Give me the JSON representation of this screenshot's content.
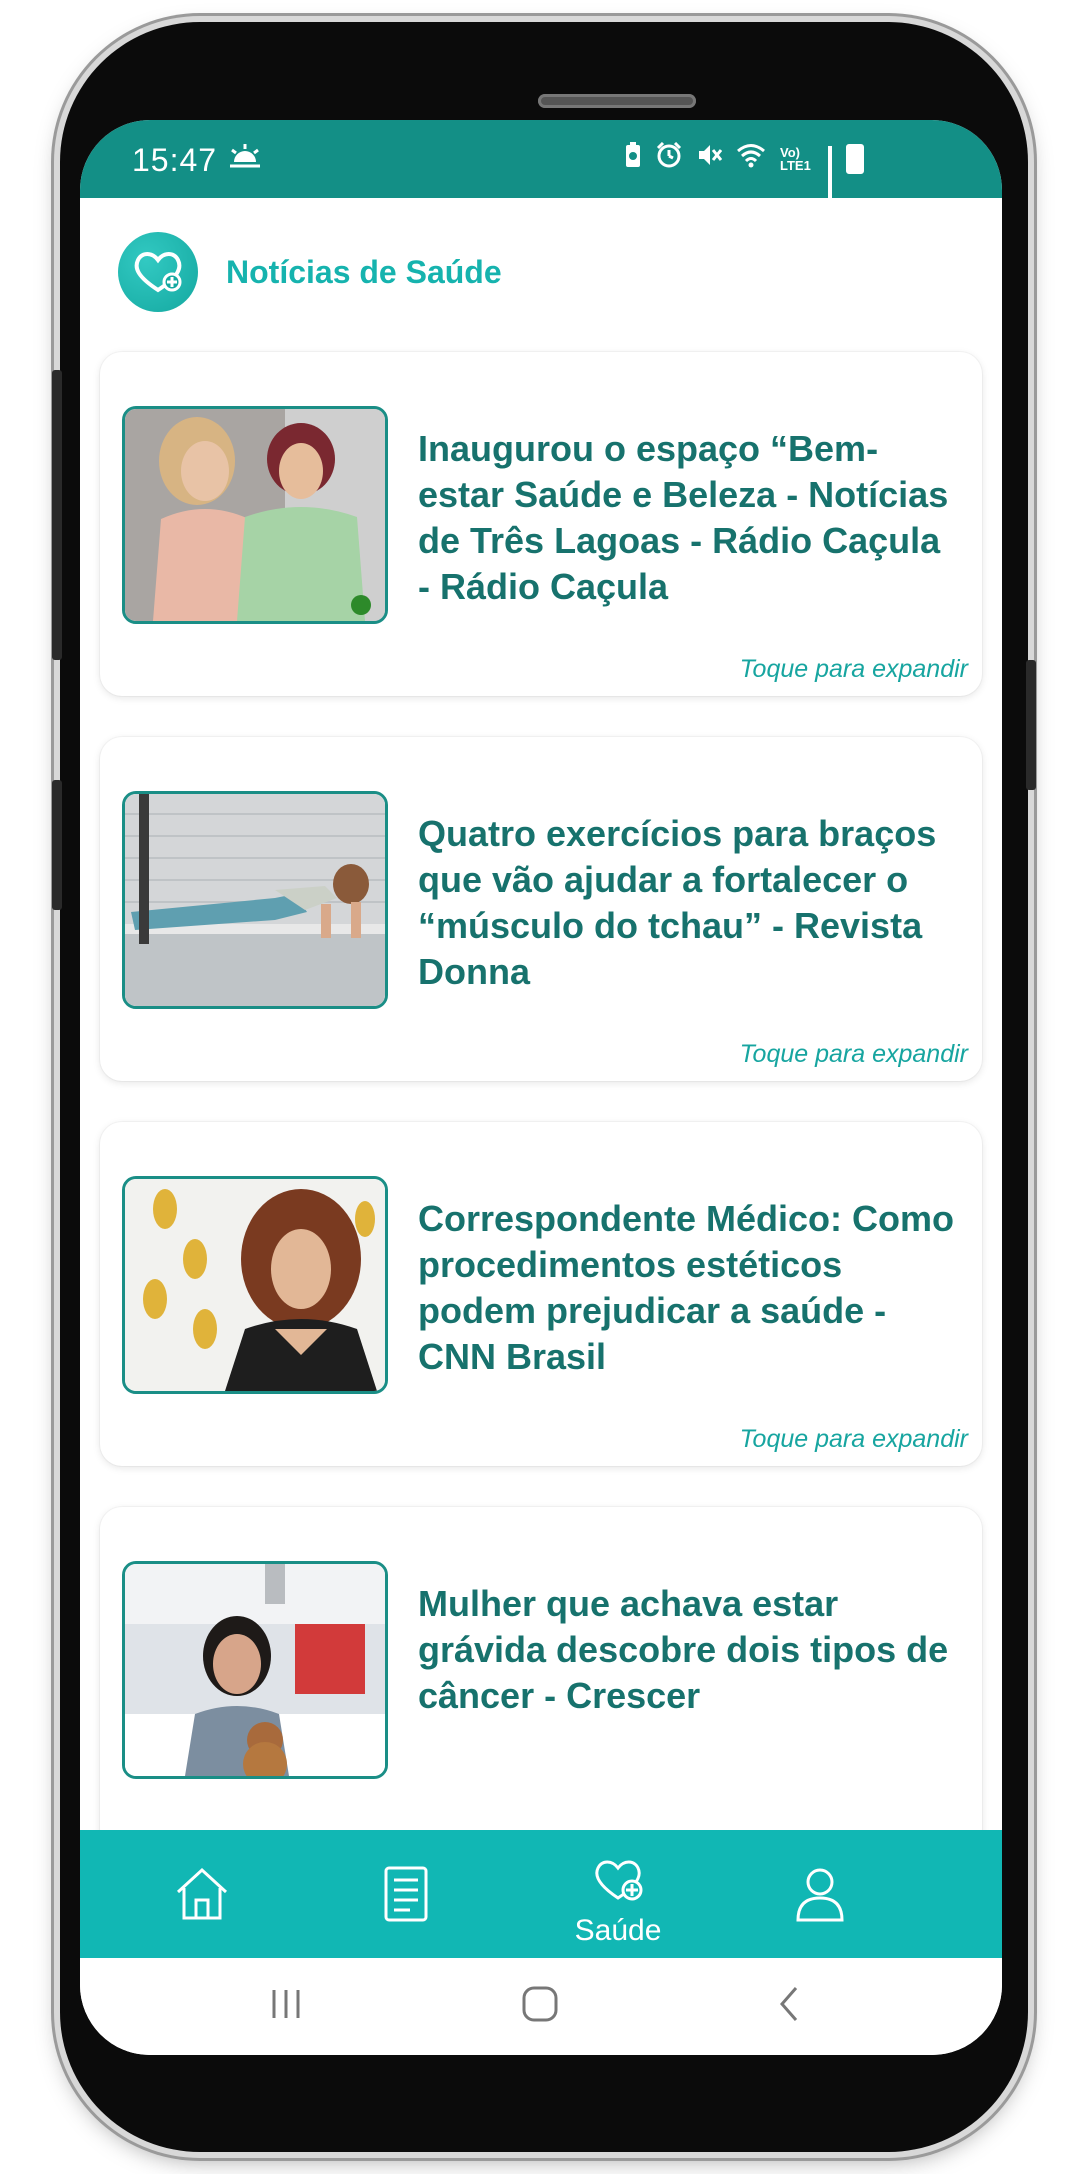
{
  "status_bar": {
    "time": "15:47",
    "weather_icon": "cloud-sun-icon",
    "network_label": "Vo) LTE1",
    "accent": "#138f86"
  },
  "header": {
    "title": "Notícias de Saúde",
    "logo_icon": "heart-plus-icon"
  },
  "cards": [
    {
      "title": "Inaugurou o espaço “Bem-estar Saúde e Beleza - Notícias de Três Lagoas - Rádio Caçula - Rádio Caçula",
      "expand_label": "Toque para expandir",
      "thumbnail": "two-women-photo"
    },
    {
      "title": "Quatro exercícios para braços que vão ajudar a fortalecer o “músculo do tchau” - Revista Donna",
      "expand_label": "Toque para expandir",
      "thumbnail": "woman-plank-photo"
    },
    {
      "title": "Correspondente Médico: Como procedimentos estéticos podem prejudicar a saúde - CNN Brasil",
      "expand_label": "Toque para expandir",
      "thumbnail": "woman-event-photo"
    },
    {
      "title": "Mulher que achava estar grávida descobre dois tipos de câncer - Crescer",
      "thumbnail": "woman-hospital-photo"
    }
  ],
  "bottom_nav": {
    "items": [
      {
        "icon": "home-icon",
        "label": ""
      },
      {
        "icon": "document-icon",
        "label": ""
      },
      {
        "icon": "heart-plus-icon",
        "label": "Saúde"
      },
      {
        "icon": "user-icon",
        "label": ""
      }
    ],
    "background": "#11b7b4"
  },
  "system_nav": {
    "icons": [
      "recents-icon",
      "home-button-icon",
      "back-icon"
    ]
  }
}
